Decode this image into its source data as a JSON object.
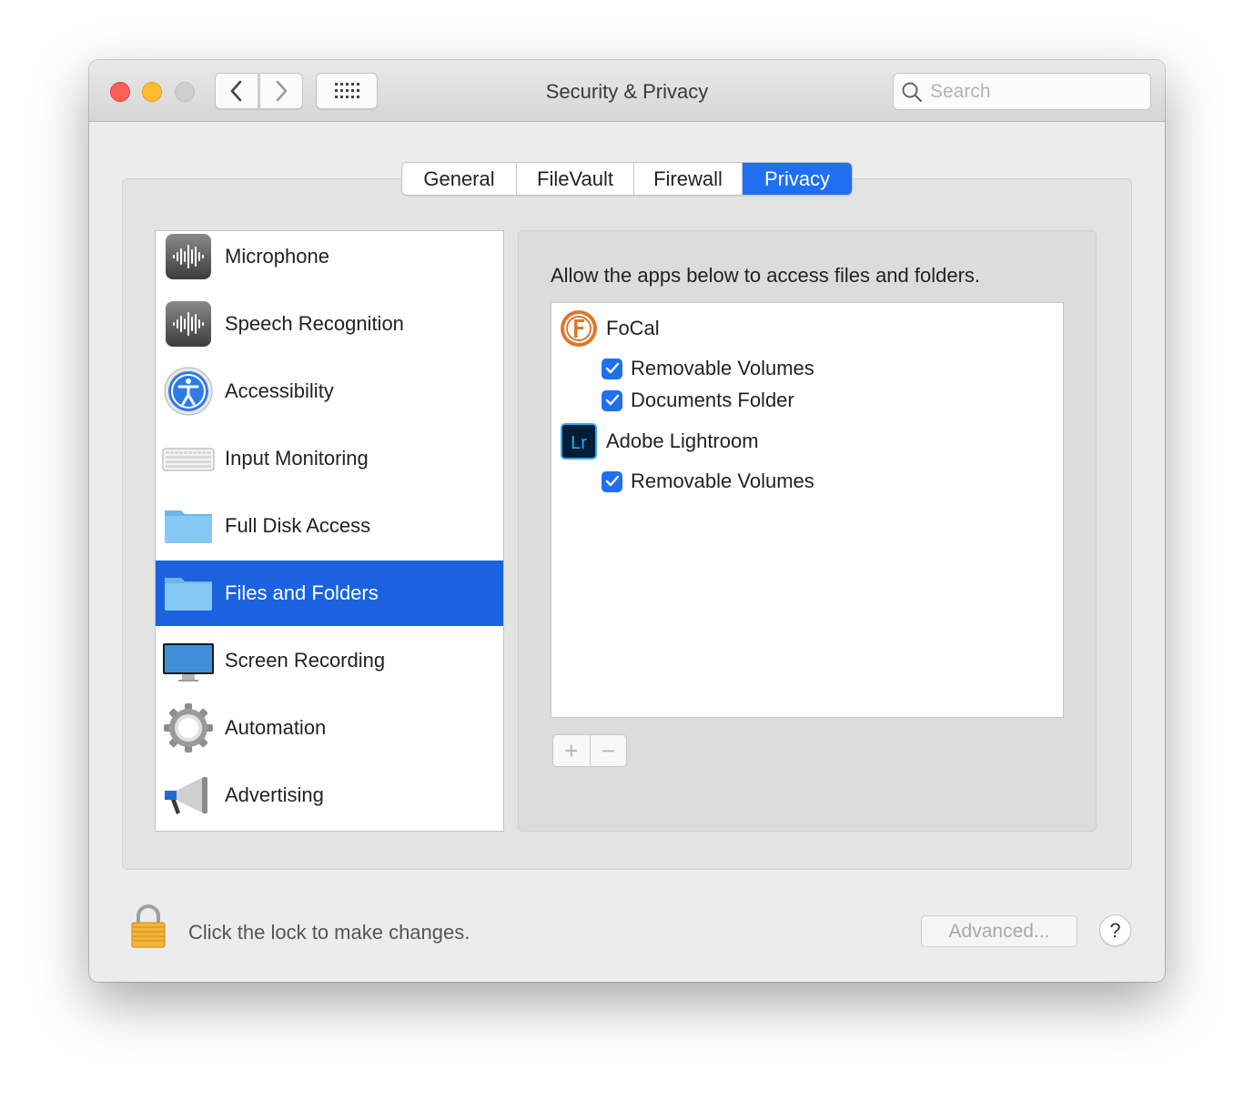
{
  "window": {
    "title": "Security & Privacy",
    "search_placeholder": "Search"
  },
  "tabs": [
    {
      "label": "General",
      "active": false
    },
    {
      "label": "FileVault",
      "active": false
    },
    {
      "label": "Firewall",
      "active": false
    },
    {
      "label": "Privacy",
      "active": true
    }
  ],
  "sidebar": {
    "items": [
      {
        "label": "Microphone",
        "icon": "microphone-icon"
      },
      {
        "label": "Speech Recognition",
        "icon": "speech-recognition-icon"
      },
      {
        "label": "Accessibility",
        "icon": "accessibility-icon"
      },
      {
        "label": "Input Monitoring",
        "icon": "keyboard-icon"
      },
      {
        "label": "Full Disk Access",
        "icon": "folder-icon"
      },
      {
        "label": "Files and Folders",
        "icon": "folder-icon",
        "selected": true
      },
      {
        "label": "Screen Recording",
        "icon": "display-icon"
      },
      {
        "label": "Automation",
        "icon": "gear-icon"
      },
      {
        "label": "Advertising",
        "icon": "megaphone-icon"
      }
    ]
  },
  "pane": {
    "heading": "Allow the apps below to access files and folders.",
    "apps": [
      {
        "name": "FoCal",
        "icon": "focal-app-icon",
        "permissions": [
          {
            "label": "Removable Volumes",
            "checked": true
          },
          {
            "label": "Documents Folder",
            "checked": true
          }
        ]
      },
      {
        "name": "Adobe Lightroom",
        "icon": "lightroom-app-icon",
        "icon_text": "Lr",
        "permissions": [
          {
            "label": "Removable Volumes",
            "checked": true
          }
        ]
      }
    ],
    "add_label": "+",
    "remove_label": "−"
  },
  "footer": {
    "lock_text": "Click the lock to make changes.",
    "advanced_label": "Advanced...",
    "help_label": "?"
  },
  "colors": {
    "accent": "#1f6ff3",
    "selection": "#1b63de"
  }
}
